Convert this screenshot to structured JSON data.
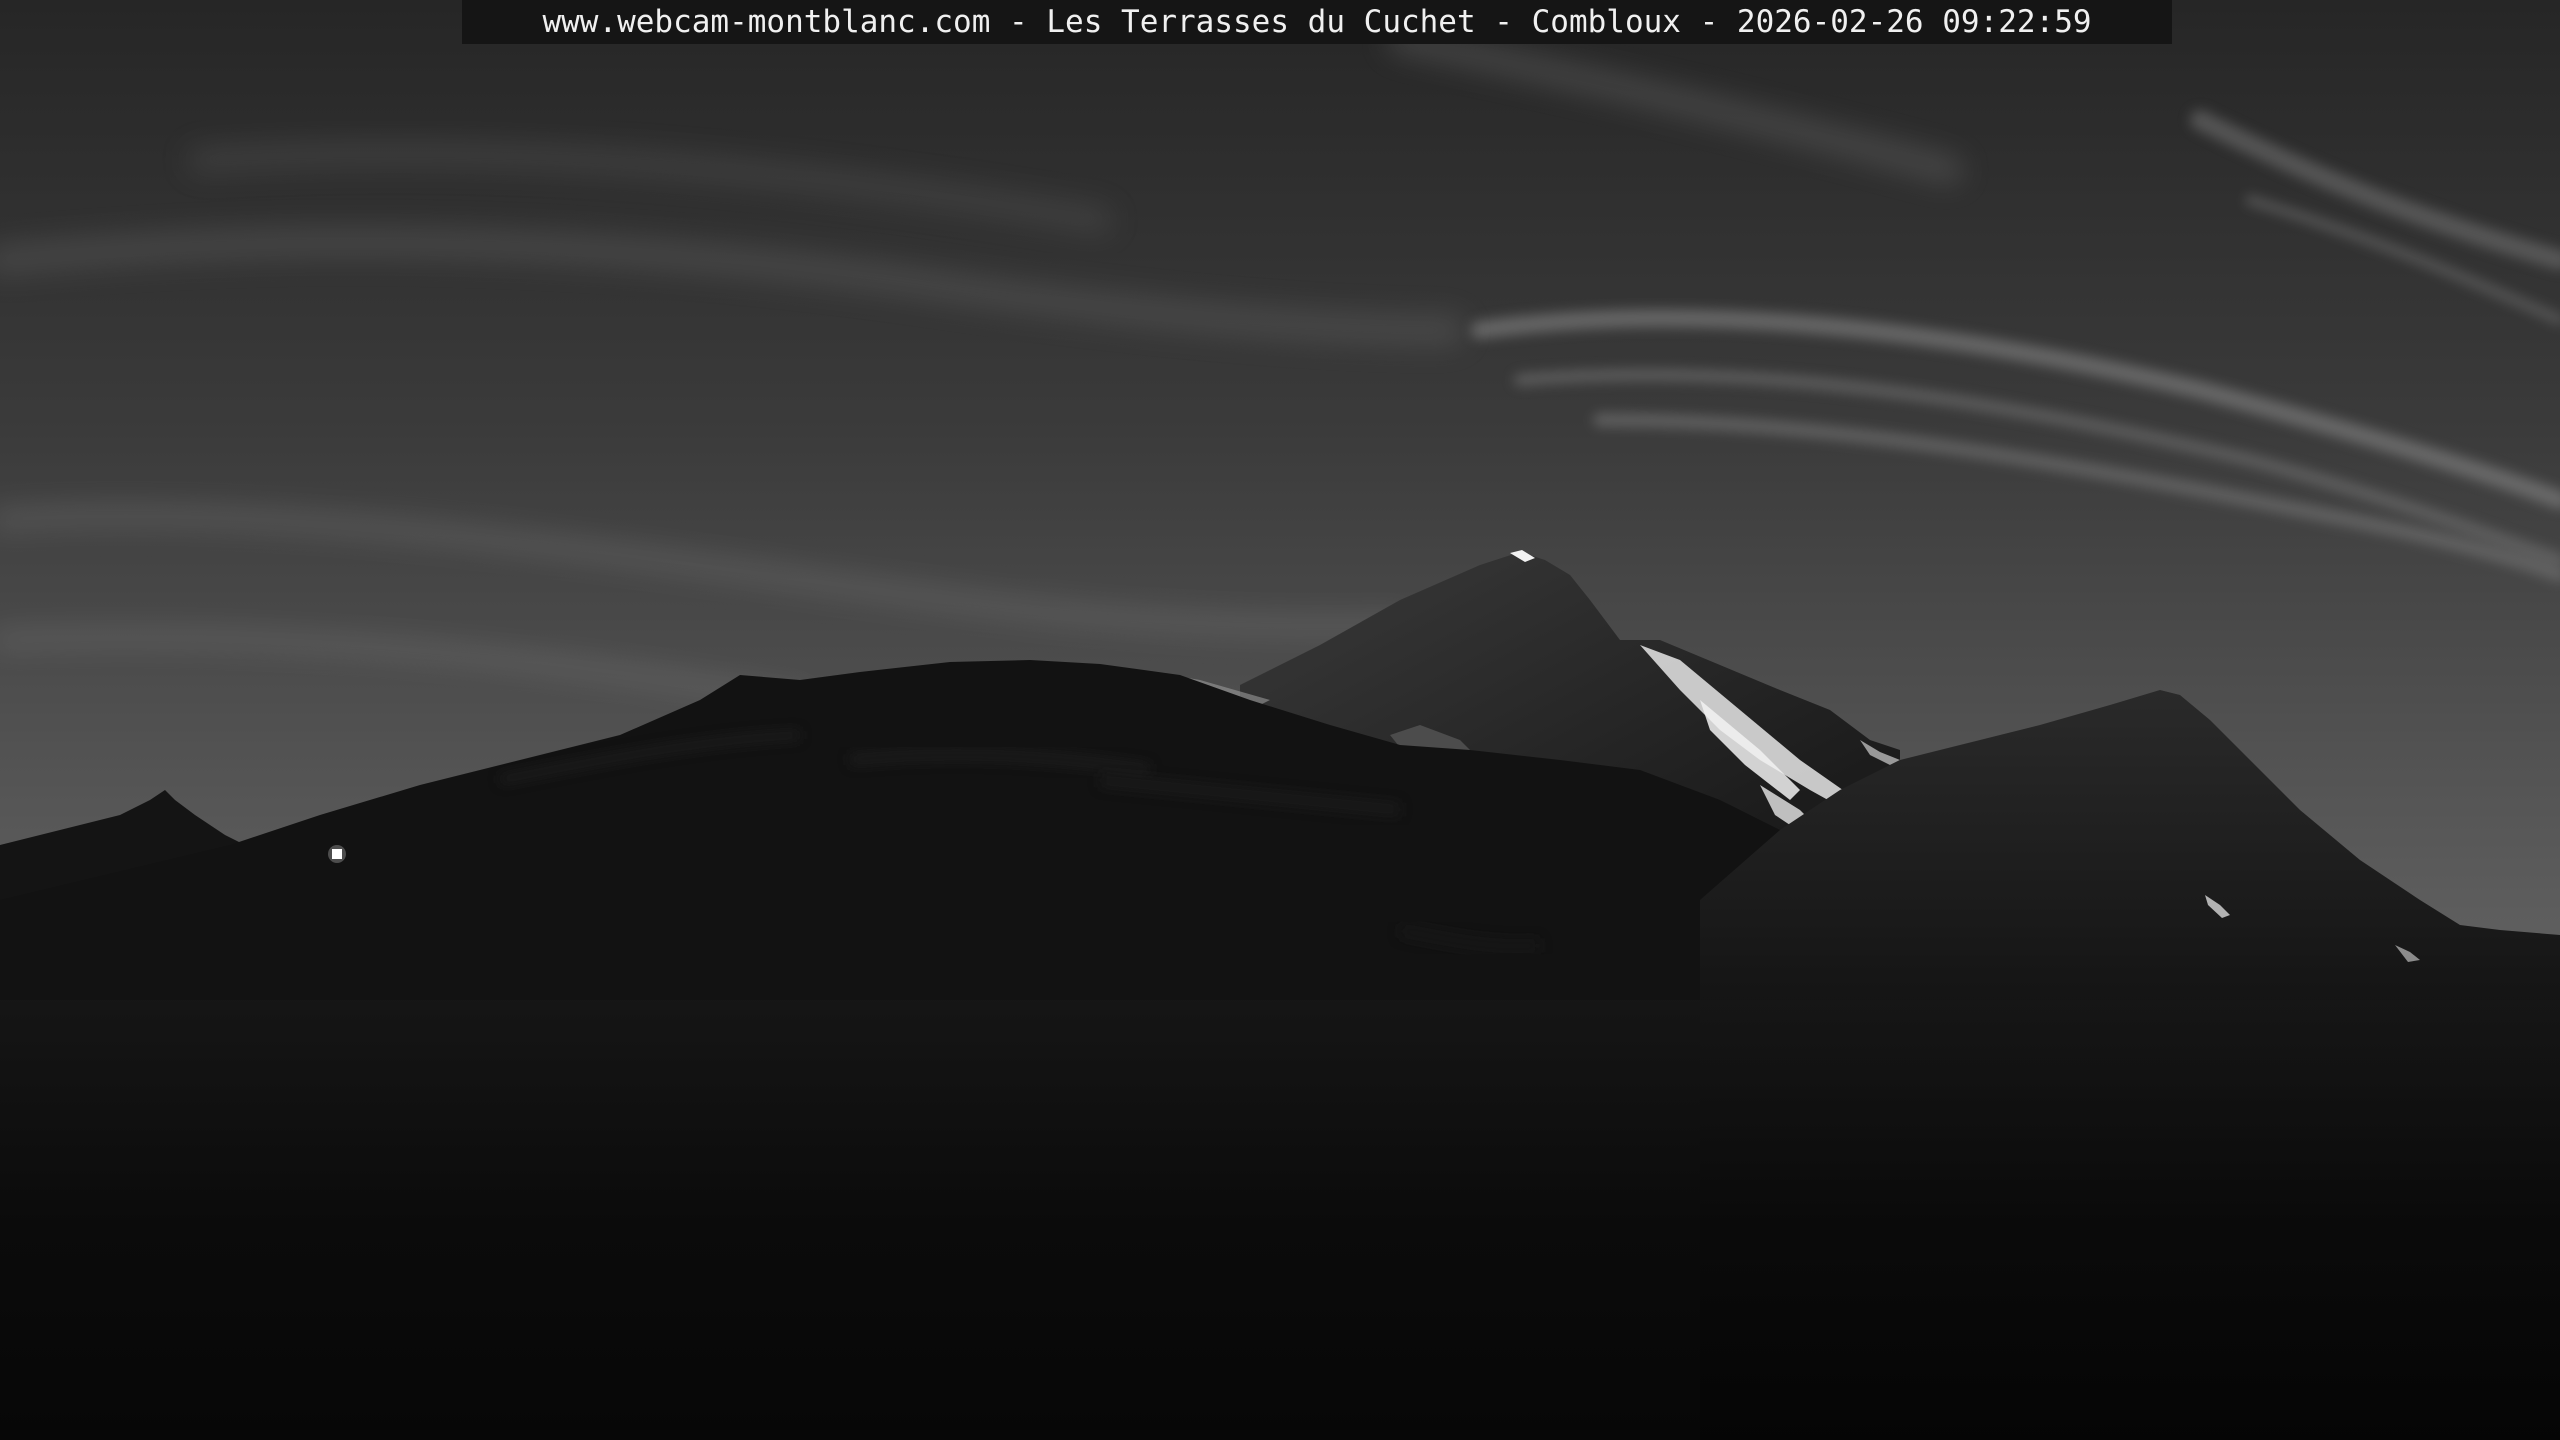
{
  "webcam": {
    "caption": "www.webcam-montblanc.com - Les Terrasses du Cuchet - Combloux - 2026-02-26 09:22:59"
  },
  "colors": {
    "sky_top": "#2a2a2a",
    "sky_mid": "#4a4a4a",
    "sky_horizon": "#6a6a6a",
    "cloud": "#9a9a9a",
    "mountain_dark": "#0a0a0a",
    "mountain_lit": "#3a3a3a",
    "snow": "#f2f2f2",
    "caption_bg": "#151515",
    "caption_text": "#f0f0f0"
  }
}
